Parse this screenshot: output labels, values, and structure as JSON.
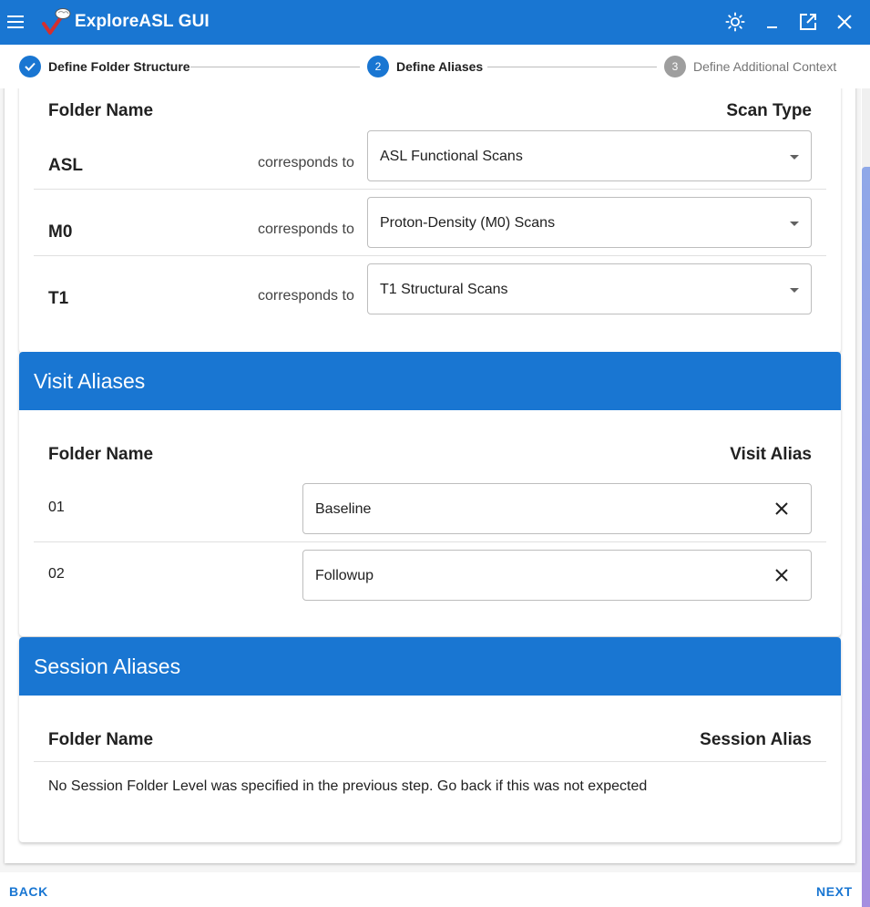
{
  "window": {
    "title": "ExploreASL GUI",
    "icons": [
      "menu-icon",
      "app-logo-icon",
      "brightness-icon",
      "minimize-icon",
      "popout-icon",
      "close-icon"
    ]
  },
  "stepper": {
    "steps": [
      {
        "number": "1",
        "label": "Define Folder Structure",
        "state": "completed"
      },
      {
        "number": "2",
        "label": "Define Aliases",
        "state": "active"
      },
      {
        "number": "3",
        "label": "Define Additional Context",
        "state": "inactive"
      }
    ]
  },
  "scan_aliases": {
    "folder_col": "Folder Name",
    "type_col": "Scan Type",
    "rows": [
      {
        "name": "ASL",
        "corr": "corresponds to",
        "value": "ASL Functional Scans"
      },
      {
        "name": "M0",
        "corr": "corresponds to",
        "value": "Proton-Density (M0) Scans"
      },
      {
        "name": "T1",
        "corr": "corresponds to",
        "value": "T1 Structural Scans"
      }
    ]
  },
  "visit_aliases": {
    "title": "Visit Aliases",
    "folder_col": "Folder Name",
    "alias_col": "Visit Alias",
    "rows": [
      {
        "name": "01",
        "value": "Baseline"
      },
      {
        "name": "02",
        "value": "Followup"
      }
    ]
  },
  "session_aliases": {
    "title": "Session Aliases",
    "folder_col": "Folder Name",
    "alias_col": "Session Alias",
    "note": "No Session Folder Level was specified in the previous step. Go back if this was not expected"
  },
  "footer": {
    "back": "BACK",
    "next": "NEXT"
  },
  "colors": {
    "primary": "#1976d2",
    "inactive_step": "#9e9e9e"
  }
}
